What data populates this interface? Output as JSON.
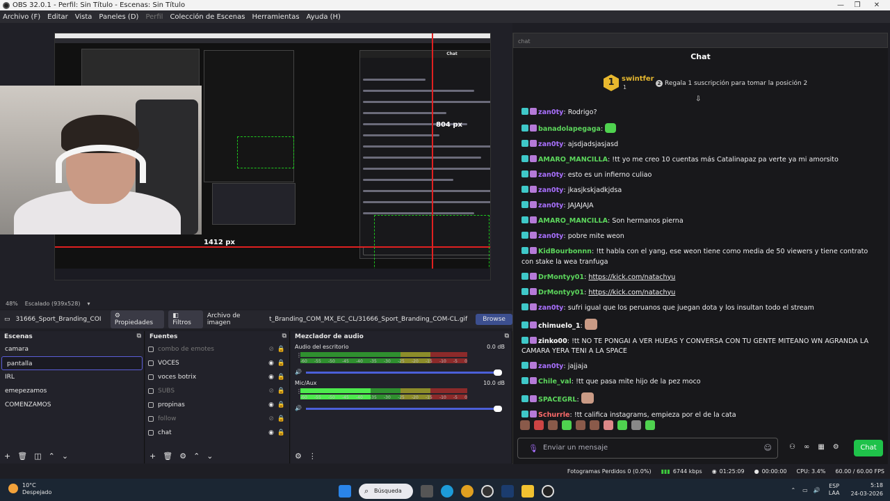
{
  "window": {
    "title": "OBS 32.0.1 - Perfil: Sin Título - Escenas: Sin Título",
    "minimize": "—",
    "maximize": "❐",
    "close": "✕"
  },
  "menu": [
    {
      "label": "Archivo (F)"
    },
    {
      "label": "Editar"
    },
    {
      "label": "Vista"
    },
    {
      "label": "Paneles (D)"
    },
    {
      "label": "Perfil"
    },
    {
      "label": "Colección de Escenas"
    },
    {
      "label": "Herramientas"
    },
    {
      "label": "Ayuda (H)"
    }
  ],
  "preview": {
    "width_label": "1412 px",
    "height_label": "804 px",
    "zoom": "48%",
    "scaling": "Escalado (939x528)"
  },
  "properties_bar": {
    "source_name": "31666_Sport_Branding_COI",
    "properties": "Propiedades",
    "filters": "Filtros",
    "image_file": "Archivo de imagen",
    "path": "t_Branding_COM_MX_EC_CL/31666_Sport_Branding_COM-CL.gif",
    "browse": "Browse"
  },
  "scenes": {
    "title": "Escenas",
    "items": [
      {
        "label": "camara"
      },
      {
        "label": "pantalla"
      },
      {
        "label": "IRL"
      },
      {
        "label": "emepezamos"
      },
      {
        "label": "COMENZAMOS"
      }
    ]
  },
  "sources": {
    "title": "Fuentes",
    "items": [
      {
        "label": "combo de emotes"
      },
      {
        "label": "VOCES"
      },
      {
        "label": "voces botrix"
      },
      {
        "label": "SUBS"
      },
      {
        "label": "propinas"
      },
      {
        "label": "follow"
      },
      {
        "label": "chat"
      }
    ]
  },
  "mixer": {
    "title": "Mezclador de audio",
    "channels": [
      {
        "name": "Audio del escritorio",
        "db": "0.0 dB",
        "level": 0.0
      },
      {
        "name": "Mic/Aux",
        "db": "10.0 dB",
        "level": 0.42
      }
    ],
    "ticks": [
      "-60",
      "-55",
      "-50",
      "-45",
      "-40",
      "-35",
      "-30",
      "-25",
      "-20",
      "-15",
      "-10",
      "-5",
      "0"
    ]
  },
  "chat": {
    "url": "chat",
    "title": "Chat",
    "pinned": {
      "rank": "1",
      "user": "swintfer",
      "count": "1",
      "gift_num": "2",
      "gift_text": "Regala 1 suscripción para tomar la posición 2"
    },
    "messages": [
      {
        "user": "zan0ty",
        "color": "#a970ff",
        "text": "Rodrigo?"
      },
      {
        "user": "banadolapegaga",
        "color": "#5cd65c",
        "text": ""
      },
      {
        "user": "zan0ty",
        "color": "#a970ff",
        "text": "ajsdjadsjasjasd"
      },
      {
        "user": "AMARO_MANCILLA",
        "color": "#5cd65c",
        "text": "!tt yo me creo 10 cuentas más Catalinapaz pa verte ya mi amorsito"
      },
      {
        "user": "zan0ty",
        "color": "#a970ff",
        "text": "esto es un infierno culiao"
      },
      {
        "user": "zan0ty",
        "color": "#a970ff",
        "text": "jkasjkskjadkjdsa"
      },
      {
        "user": "zan0ty",
        "color": "#a970ff",
        "text": "JAJAJAJA"
      },
      {
        "user": "AMARO_MANCILLA",
        "color": "#5cd65c",
        "text": "Son hermanos pierna"
      },
      {
        "user": "zan0ty",
        "color": "#a970ff",
        "text": "pobre mite weon"
      },
      {
        "user": "KidBourbonnn",
        "color": "#5cd65c",
        "text": "!tt habla con el yang, ese weon tiene como media de 50 viewers y tiene contrato con stake la wea tranfuga"
      },
      {
        "user": "DrMontyy01",
        "color": "#5cd65c",
        "text": "https://kick.com/natachyu"
      },
      {
        "user": "DrMontyy01",
        "color": "#5cd65c",
        "text": "https://kick.com/natachyu"
      },
      {
        "user": "zan0ty",
        "color": "#a970ff",
        "text": "sufri igual que los peruanos que juegan dota y los insultan todo el stream"
      },
      {
        "user": "chimuelo_1",
        "color": "#ffffff",
        "text": ""
      },
      {
        "user": "zinko00",
        "color": "#ffffff",
        "text": "!tt NO TE PONGAI A VER HUEAS Y CONVERSA CON TU GENTE MITEANO WN AGRANDA LA CAMARA YERA TENI A LA SPACE"
      },
      {
        "user": "zan0ty",
        "color": "#a970ff",
        "text": "jajjaja"
      },
      {
        "user": "Chile_val",
        "color": "#5cd65c",
        "text": "!tt que pasa mite hijo de la pez moco"
      },
      {
        "user": "SPACEGRL",
        "color": "#5cd65c",
        "text": ""
      },
      {
        "user": "Schurrle",
        "color": "#ff6b6b",
        "text": "!tt califica instagrams, empieza por el de la cata"
      }
    ],
    "input_placeholder": "Enviar un mensaje",
    "send_button": "Chat"
  },
  "status": {
    "dropped": "Fotogramas Perdidos 0 (0.0%)",
    "bitrate": "6744 kbps",
    "live_time": "01:25:09",
    "rec_time": "00:00:00",
    "cpu": "CPU: 3.4%",
    "fps": "60.00 / 60.00 FPS"
  },
  "taskbar": {
    "temp": "10°C",
    "weather": "Despejado",
    "search": "Búsqueda",
    "lang1": "ESP",
    "lang2": "LAA",
    "time": "5:18",
    "date": "24-03-2026"
  },
  "colors": {
    "accent": "#5b5ed8",
    "chat_send": "#1fc24a",
    "kick_purple": "#a970ff"
  }
}
